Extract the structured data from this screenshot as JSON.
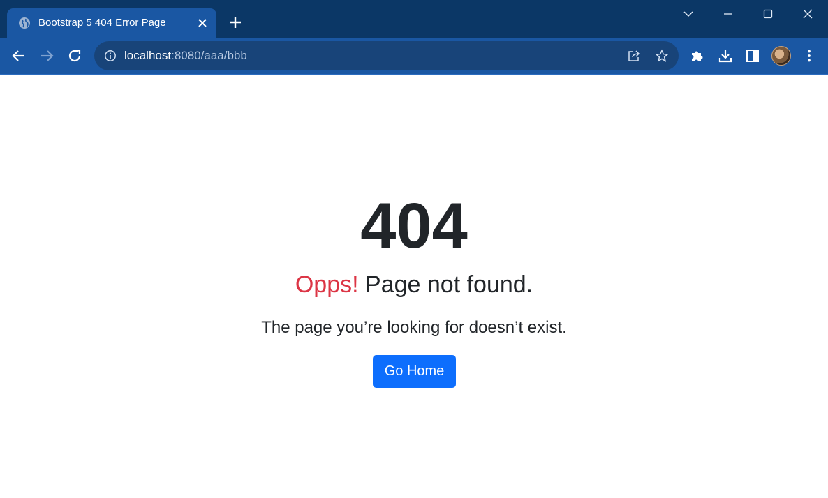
{
  "browser": {
    "tab": {
      "title": "Bootstrap 5 404 Error Page",
      "favicon": "globe-icon"
    },
    "address_bar": {
      "host": "localhost",
      "path": ":8080/aaa/bbb"
    },
    "colors": {
      "titlebar": "#0b3766",
      "toolbar": "#1a57a3",
      "omnibox": "#184479"
    }
  },
  "page": {
    "code": "404",
    "headline_accent": "Opps!",
    "headline_rest": " Page not found.",
    "lead": "The page you’re looking for doesn’t exist.",
    "button_label": "Go Home",
    "colors": {
      "accent": "#dc3545",
      "primary": "#0d6efd",
      "text": "#212529"
    }
  }
}
